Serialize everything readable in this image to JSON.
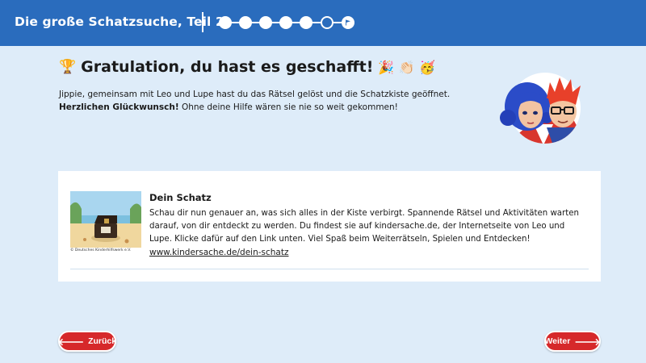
{
  "header": {
    "title": "Die große Schatzsuche, Teil 2",
    "progress": {
      "total_steps": 7,
      "completed": 5,
      "current": 6
    }
  },
  "main": {
    "heading_emoji": "🏆",
    "heading": "Gratulation, du hast es geschafft!",
    "heading_emojis_after": "🎉 👏🏻 🥳",
    "intro_line1": "Jippie, gemeinsam mit Leo und Lupe hast du das Rätsel gelöst und die Schatzkiste geöffnet.",
    "intro_bold": "Herzlichen Glückwunsch!",
    "intro_line2": " Ohne deine Hilfe wären sie nie so weit gekommen!"
  },
  "card": {
    "image_caption": "© Deutsches Kinderhilfswerk e.V.",
    "title": "Dein Schatz",
    "text": "Schau dir nun genauer an, was sich alles in der Kiste verbirgt. Spannende Rätsel und Aktivitäten warten darauf, von dir entdeckt zu werden. Du findest sie auf kindersache.de, der Internetseite von Leo und Lupe. Klicke dafür auf den Link unten. Viel Spaß beim Weiterrätseln, Spielen und Entdecken!",
    "link": "www.kindersache.de/dein-schatz"
  },
  "nav": {
    "back_label": "Zurück",
    "next_label": "Weiter",
    "back_arrow": "🡐",
    "next_arrow": "🡒"
  },
  "colors": {
    "header_bg": "#2a6cbd",
    "page_bg": "#deecf9",
    "button_red": "#d6282a"
  }
}
